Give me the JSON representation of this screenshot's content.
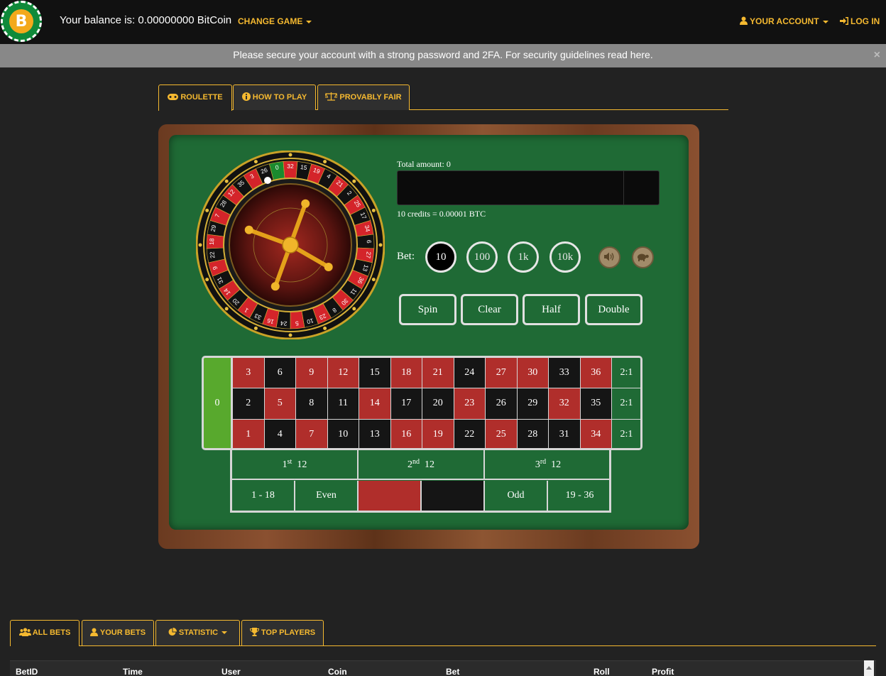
{
  "header": {
    "logo_letter": "B",
    "balance": "Your balance is: 0.00000000 BitCoin",
    "change_game": "CHANGE GAME",
    "your_account": "YOUR ACCOUNT",
    "log_in": "LOG IN"
  },
  "alert": {
    "message": "Please secure your account with a strong password and 2FA. For security guidelines read here.",
    "close": "×"
  },
  "game_tabs": [
    {
      "label": "ROULETTE",
      "icon": "gamepad-icon",
      "active": true
    },
    {
      "label": "HOW TO PLAY",
      "icon": "info-icon",
      "active": false
    },
    {
      "label": "PROVABLY FAIR",
      "icon": "scale-icon",
      "active": false
    }
  ],
  "game": {
    "total_amount": "Total amount: 0",
    "credits_rate": "10 credits = 0.00001 BTC",
    "bet_label": "Bet:",
    "chips": [
      "10",
      "100",
      "1k",
      "10k"
    ],
    "selected_chip": "10",
    "actions": [
      "Spin",
      "Clear",
      "Half",
      "Double"
    ],
    "wheel_numbers": [
      "0",
      "32",
      "15",
      "19",
      "4",
      "21",
      "2",
      "25",
      "17",
      "34",
      "6",
      "27",
      "13",
      "36",
      "11",
      "30",
      "8",
      "23",
      "10",
      "5",
      "24",
      "16",
      "33",
      "1",
      "20",
      "14",
      "31",
      "9",
      "22",
      "18",
      "29",
      "7",
      "28",
      "12",
      "35",
      "3",
      "26"
    ]
  },
  "board": {
    "zero": "0",
    "rows": [
      [
        {
          "n": "3",
          "c": "red"
        },
        {
          "n": "6",
          "c": "black"
        },
        {
          "n": "9",
          "c": "red"
        },
        {
          "n": "12",
          "c": "red"
        },
        {
          "n": "15",
          "c": "black"
        },
        {
          "n": "18",
          "c": "red"
        },
        {
          "n": "21",
          "c": "red"
        },
        {
          "n": "24",
          "c": "black"
        },
        {
          "n": "27",
          "c": "red"
        },
        {
          "n": "30",
          "c": "red"
        },
        {
          "n": "33",
          "c": "black"
        },
        {
          "n": "36",
          "c": "red"
        }
      ],
      [
        {
          "n": "2",
          "c": "black"
        },
        {
          "n": "5",
          "c": "red"
        },
        {
          "n": "8",
          "c": "black"
        },
        {
          "n": "11",
          "c": "black"
        },
        {
          "n": "14",
          "c": "red"
        },
        {
          "n": "17",
          "c": "black"
        },
        {
          "n": "20",
          "c": "black"
        },
        {
          "n": "23",
          "c": "red"
        },
        {
          "n": "26",
          "c": "black"
        },
        {
          "n": "29",
          "c": "black"
        },
        {
          "n": "32",
          "c": "red"
        },
        {
          "n": "35",
          "c": "black"
        }
      ],
      [
        {
          "n": "1",
          "c": "red"
        },
        {
          "n": "4",
          "c": "black"
        },
        {
          "n": "7",
          "c": "red"
        },
        {
          "n": "10",
          "c": "black"
        },
        {
          "n": "13",
          "c": "black"
        },
        {
          "n": "16",
          "c": "red"
        },
        {
          "n": "19",
          "c": "red"
        },
        {
          "n": "22",
          "c": "black"
        },
        {
          "n": "25",
          "c": "red"
        },
        {
          "n": "28",
          "c": "black"
        },
        {
          "n": "31",
          "c": "black"
        },
        {
          "n": "34",
          "c": "red"
        }
      ]
    ],
    "column_bet": "2:1",
    "dozens": [
      {
        "num": "1",
        "sup": "st",
        "val": "12"
      },
      {
        "num": "2",
        "sup": "nd",
        "val": "12"
      },
      {
        "num": "3",
        "sup": "rd",
        "val": "12"
      }
    ],
    "low": "1 - 18",
    "even": "Even",
    "odd": "Odd",
    "high": "19 - 36"
  },
  "bets_tabs": [
    {
      "label": "ALL BETS",
      "icon": "users-icon",
      "active": true
    },
    {
      "label": "YOUR BETS",
      "icon": "user-icon",
      "active": false
    },
    {
      "label": "STATISTIC",
      "icon": "pie-chart-icon",
      "active": false
    },
    {
      "label": "TOP PLAYERS",
      "icon": "trophy-icon",
      "active": false
    }
  ],
  "bets_table": {
    "columns": [
      "BetID",
      "Time",
      "User",
      "Coin",
      "Bet",
      "Roll",
      "Profit"
    ]
  },
  "colors": {
    "accent": "#f5b930",
    "felt": "#1f6a35",
    "red": "#b02e2b",
    "black": "#151515",
    "zero_green": "#58a92d"
  }
}
